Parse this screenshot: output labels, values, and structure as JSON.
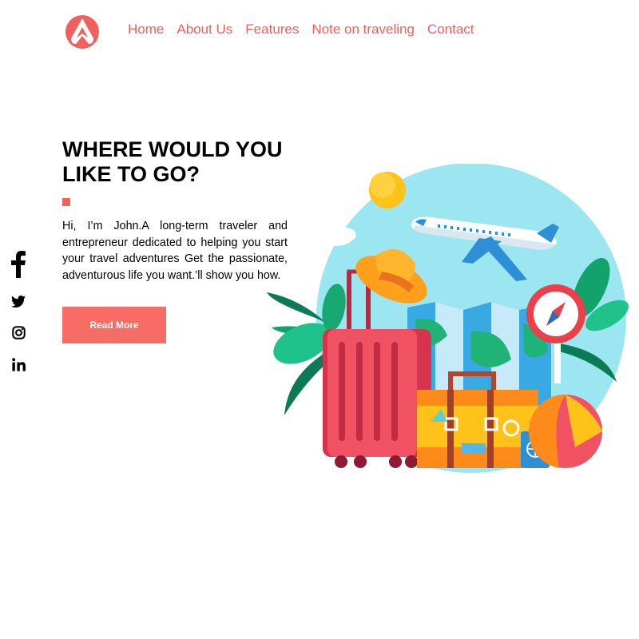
{
  "nav": {
    "items": [
      {
        "label": "Home"
      },
      {
        "label": "About Us"
      },
      {
        "label": "Features"
      },
      {
        "label": "Note on traveling"
      },
      {
        "label": "Contact"
      }
    ]
  },
  "hero": {
    "title": "WHERE WOULD YOU LIKE TO GO?",
    "intro": "Hi, I’m John.A long-term traveler and entrepreneur dedicated to helping you start your travel adventures Get the passionate, adventurous life you want.’ll show you how.",
    "button_label": "Read More"
  },
  "social": [
    "facebook-icon",
    "twitter-icon",
    "instagram-icon",
    "linkedin-icon"
  ],
  "colors": {
    "accent": "#f0605d",
    "button": "#f86c66",
    "sky": "#9be6f0"
  }
}
